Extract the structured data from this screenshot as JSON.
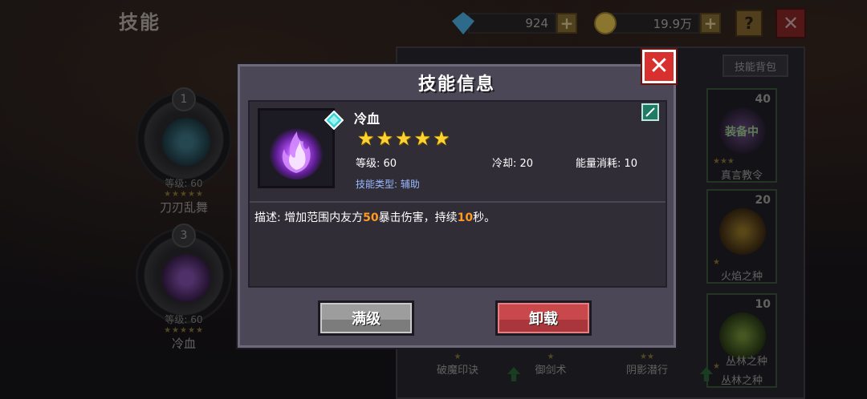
{
  "screen": {
    "title": "技能",
    "gems": "924",
    "gold": "19.9万",
    "help_label": "?",
    "close_label": "✕"
  },
  "equipped_slots": [
    {
      "slot_number": "1",
      "level": "等级: 60",
      "stars": "★★★★★",
      "name": "刀刃乱舞"
    },
    {
      "slot_number": "3",
      "level": "等级: 60",
      "stars": "★★★★★",
      "name": "冷血"
    }
  ],
  "backpack": {
    "tab_label": "技能背包",
    "cards": [
      {
        "count": "40",
        "stars": "★★★",
        "name": "真言教令",
        "status": "装备中"
      },
      {
        "count": "20",
        "stars": "★",
        "name": "火焰之种"
      },
      {
        "count": "10",
        "stars": "★",
        "name": "丛林之种"
      }
    ],
    "bottom_row": [
      {
        "stars": "★",
        "name": "破魔印诀"
      },
      {
        "stars": "★",
        "name": "御剑术"
      },
      {
        "stars": "★★",
        "name": "阴影潜行"
      },
      {
        "stars": "",
        "name": "丛林之种"
      }
    ]
  },
  "modal": {
    "title": "技能信息",
    "close_label": "✕",
    "skill": {
      "name": "冷血",
      "stars": 5,
      "level_label": "等级: 60",
      "cooldown_label": "冷却: 20",
      "energy_label": "能量消耗: 10",
      "type_prefix": "技能类型: ",
      "type_value": "辅助"
    },
    "description": {
      "prefix": "描述: 增加范围内友方",
      "value1": "50",
      "middle": "暴击伤害，持续",
      "value2": "10",
      "suffix": "秒。"
    },
    "buttons": {
      "max_label": "满级",
      "unload_label": "卸载"
    }
  },
  "colors": {
    "highlight": "#ff9a22",
    "star": "#ffd234",
    "type_text": "#9ab8ff",
    "close_red": "#d8302e",
    "unload_red": "#c8484c"
  }
}
